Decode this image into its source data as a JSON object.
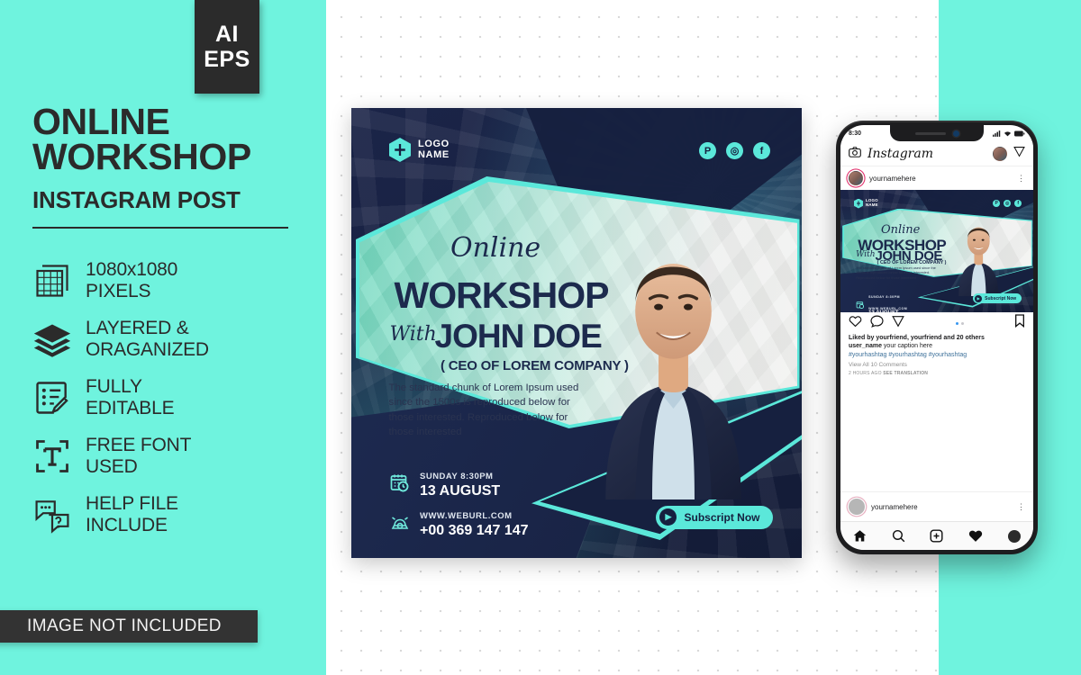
{
  "badge": {
    "line1": "AI",
    "line2": "EPS"
  },
  "lead": {
    "title_line1": "ONLINE",
    "title_line2": "WORKSHOP",
    "subtitle": "INSTAGRAM POST"
  },
  "features": [
    {
      "icon": "artboard-size-icon",
      "label": "1080x1080\nPIXELS"
    },
    {
      "icon": "layers-icon",
      "label": "LAYERED &\nORAGANIZED"
    },
    {
      "icon": "edit-document-icon",
      "label": "FULLY\nEDITABLE"
    },
    {
      "icon": "free-font-icon",
      "label": "FREE FONT\nUSED"
    },
    {
      "icon": "help-chat-icon",
      "label": "HELP FILE\nINCLUDE"
    }
  ],
  "notice": "IMAGE NOT INCLUDED",
  "post": {
    "logo_line1": "LOGO",
    "logo_line2": "NAME",
    "socials": [
      {
        "name": "pinterest-icon",
        "glyph": "P"
      },
      {
        "name": "instagram-icon",
        "glyph": "◎"
      },
      {
        "name": "facebook-icon",
        "glyph": "f"
      }
    ],
    "script_word": "Online",
    "headline": "WORKSHOP",
    "with_word": "With",
    "speaker_name": "JOHN DOE",
    "speaker_title": "( CEO  OF LOREM COMPANY )",
    "body": "The standard chunk of Lorem Ipsum used since the 1500s is reproduced below for those interested. Reproduced below for those interested",
    "date_small": "SUNDAY 8:30PM",
    "date_big": "13 AUGUST",
    "web_small": "WWW.WEBURL.COM",
    "phone_big": "+00 369 147 147",
    "cta": "Subscript Now"
  },
  "phone": {
    "status_time": "8:30",
    "app_title": "Instagram",
    "post_user": "yournamehere",
    "liked_by": "Liked by yourfriend, yourfriend and 20 others",
    "caption_user": "user_name",
    "caption_text": "your caption here",
    "hashtags": "#yourhashtag #yourhashtag #yourhashtag",
    "view_comments": "View All 10 Comments",
    "meta_time": "2 HOURS AGO",
    "meta_translate": "SEE TRANSLATION",
    "next_user": "yournamehere"
  },
  "colors": {
    "mint_bg": "#6FF3DE",
    "accent": "#5BE8DA",
    "navy": "#16203f",
    "dark": "#2b2b2b"
  }
}
